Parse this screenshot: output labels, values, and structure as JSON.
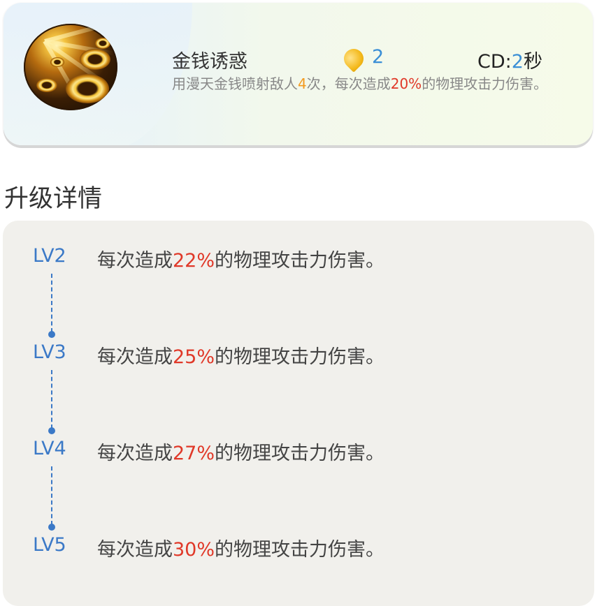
{
  "skill": {
    "name": "金钱诱惑",
    "cost": "2",
    "cd_prefix": "CD:",
    "cd_value": "2",
    "cd_unit": "秒",
    "desc_part1": "用漫天金钱喷射敌人",
    "desc_count": "4",
    "desc_part2": "次，每次造成",
    "desc_percent": "20%",
    "desc_part3": "的物理攻击力伤害。",
    "icon": "gold-coin-burst-icon",
    "cost_icon": "energy-drop-icon"
  },
  "upgrade": {
    "title": "升级详情",
    "levels": [
      {
        "label": "LV2",
        "prefix": "每次造成",
        "percent": "22%",
        "suffix": "的物理攻击力伤害。"
      },
      {
        "label": "LV3",
        "prefix": "每次造成",
        "percent": "25%",
        "suffix": "的物理攻击力伤害。"
      },
      {
        "label": "LV4",
        "prefix": "每次造成",
        "percent": "27%",
        "suffix": "的物理攻击力伤害。"
      },
      {
        "label": "LV5",
        "prefix": "每次造成",
        "percent": "30%",
        "suffix": "的物理攻击力伤害。"
      }
    ]
  },
  "colors": {
    "accent_blue": "#3b79c7",
    "highlight_red": "#e03828",
    "highlight_orange": "#f39a1f"
  }
}
